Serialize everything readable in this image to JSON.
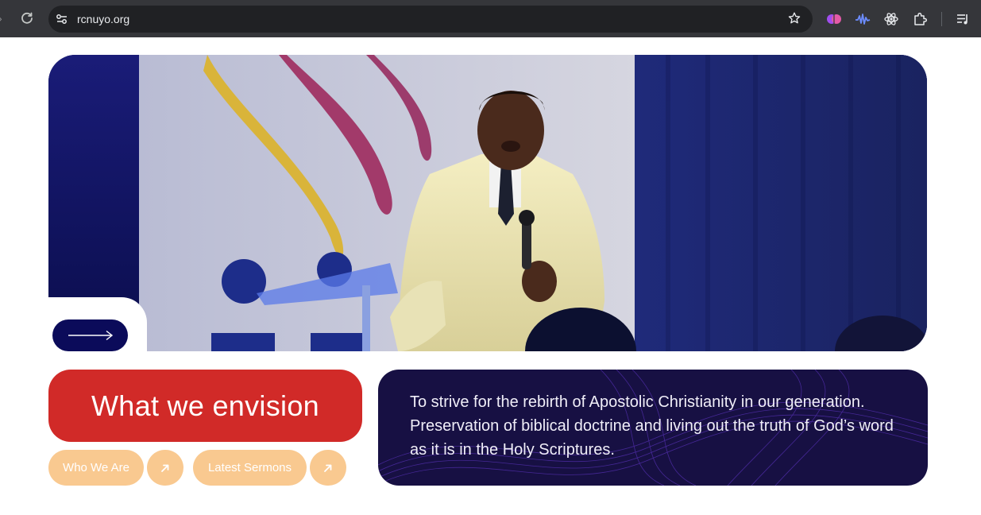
{
  "browser": {
    "url": "rcnuyo.org"
  },
  "hero": {
    "image_alt": "Preacher speaking on stage with microphone"
  },
  "envision": {
    "heading": "What we envision"
  },
  "links": {
    "who_we_are": "Who We Are",
    "latest_sermons": "Latest Sermons"
  },
  "mission": {
    "text": "To strive for the rebirth of Apostolic Christianity in our generation. Preservation of biblical doctrine and living out the truth of God’s word as it is in the Holy Scriptures."
  },
  "colors": {
    "brand_red": "#d12a28",
    "brand_navy": "#0b0b5a",
    "mission_bg": "#171043",
    "pill_peach": "#f9c990"
  },
  "icons": [
    "reload-icon",
    "site-settings-icon",
    "bookmark-star-icon",
    "extension-icon",
    "arrow-right-icon",
    "arrow-up-right-icon"
  ]
}
